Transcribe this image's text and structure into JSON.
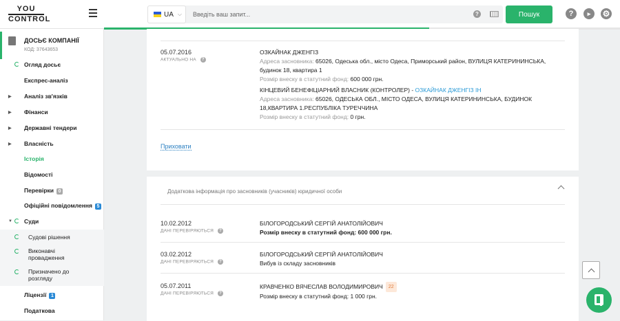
{
  "header": {
    "logo_top": "YOU",
    "logo_bottom": "CONTROL",
    "lang": "UA",
    "search_placeholder": "Введіть ваш запит...",
    "search_button": "Пошук",
    "progress_percent": 63
  },
  "sidebar": {
    "dossier_title": "ДОСЬЄ КОМПАНІЇ",
    "dossier_code": "КОД: 37643653",
    "items": [
      {
        "label": "Огляд досьє",
        "active": false
      },
      {
        "label": "Експрес-аналіз",
        "active": false
      },
      {
        "label": "Аналіз зв'язків",
        "active": false
      },
      {
        "label": "Фінанси",
        "active": false
      },
      {
        "label": "Державні тендери",
        "active": false
      },
      {
        "label": "Власність",
        "active": false
      },
      {
        "label": "Історія",
        "active": true
      },
      {
        "label": "Відомості",
        "active": false
      },
      {
        "label": "Перевірки",
        "badge": "0",
        "badge_color": "#aaaaaa"
      },
      {
        "label": "Офіційні повідомлення",
        "badge": "5",
        "badge_color": "#2a8ad6"
      },
      {
        "label": "Суди",
        "active": false
      },
      {
        "label": "Ліцензії",
        "badge": "1",
        "badge_color": "#2a8ad6"
      },
      {
        "label": "Податкова",
        "active": false
      }
    ],
    "courts_sub": [
      "Судові рішення",
      "Виконавчі провадження",
      "Призначено до розгляду"
    ]
  },
  "card1": {
    "date": "05.07.2016",
    "date_label": "АКТУАЛЬНО НА",
    "founder1_name": "ОЗКАЙНАК ДЖЕНГІЗ",
    "founder1_addr_label": "Адреса засновника:",
    "founder1_addr": "65026, Одеська обл., місто Одеса, Приморський район, ВУЛИЦЯ КАТЕРИНИНСЬКА, будинок 18, квартира 1",
    "founder1_fund_label": "Розмір внеску в статутний фонд:",
    "founder1_fund": "600 000 грн.",
    "founder2_title": "КІНЦЕВИЙ БЕНЕФІЦІАРНИЙ ВЛАСНИК (КОНТРОЛЕР) -",
    "founder2_link": "ОЗКАЙНАК ДЖЕНГІЗ ІН",
    "founder2_addr_label": "Адреса засновника:",
    "founder2_addr": "65026, ОДЕСЬКА ОБЛ., МІСТО ОДЕСА, ВУЛИЦЯ КАТЕРИНИНСЬКА, БУДИНОК 18,КВАРТИРА 1.РЕСПУБЛІКА ТУРЕЧЧИНА",
    "founder2_fund_label": "Розмір внеску в статутний фонд:",
    "founder2_fund": "0 грн.",
    "hide_link": "Приховати"
  },
  "card2": {
    "title": "Додаткова інформація про засновників (учасників) юридичної особи",
    "rows": [
      {
        "date": "10.02.2012",
        "label": "ДАНІ ПЕРЕВІРЯЮТЬСЯ",
        "name": "БІЛОГОРОДСЬКИЙ СЕРГІЙ АНАТОЛІЙОВИЧ",
        "detail": "Розмір внеску в статутний фонд: 600 000 грн.",
        "badge": ""
      },
      {
        "date": "03.02.2012",
        "label": "ДАНІ ПЕРЕВІРЯЮТЬСЯ",
        "name": "БІЛОГОРОДСЬКИЙ СЕРГІЙ АНАТОЛІЙОВИЧ",
        "detail": "Вибув із складу засновників",
        "badge": ""
      },
      {
        "date": "05.07.2011",
        "label": "ДАНІ ПЕРЕВІРЯЮТЬСЯ",
        "name": "КРАВЧЕНКО ВЯЧЕСЛАВ ВОЛОДИМИРОВИЧ",
        "detail": "Розмір внеску в статутний фонд: 1 000 грн.",
        "badge": "22"
      }
    ]
  }
}
